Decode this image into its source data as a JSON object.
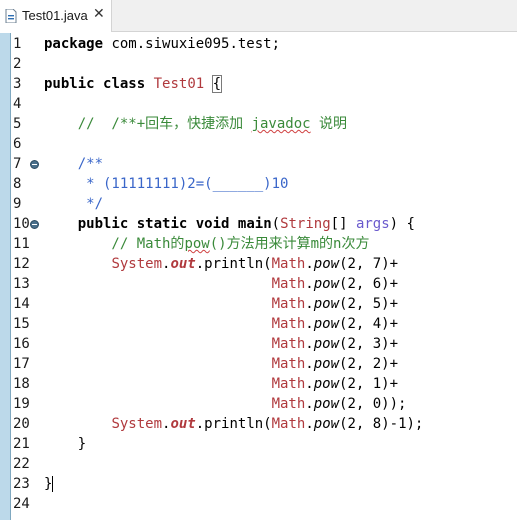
{
  "tab": {
    "icon": "java-file-icon",
    "title": "Test01.java",
    "close": "✕"
  },
  "code_lines": [
    {
      "n": "1",
      "tokens": [
        {
          "t": "package",
          "c": "kw"
        },
        {
          "t": " com.siwuxie095.test;",
          "c": ""
        }
      ]
    },
    {
      "n": "2",
      "tokens": []
    },
    {
      "n": "3",
      "tokens": [
        {
          "t": "public",
          "c": "kw"
        },
        {
          "t": " ",
          "c": ""
        },
        {
          "t": "class",
          "c": "kw"
        },
        {
          "t": " ",
          "c": ""
        },
        {
          "t": "Test01",
          "c": "cls"
        },
        {
          "t": " ",
          "c": ""
        },
        {
          "t": "{",
          "c": "brace-box"
        }
      ]
    },
    {
      "n": "4",
      "tokens": []
    },
    {
      "n": "5",
      "tokens": [
        {
          "t": "    //  /**+回车，快捷添加 ",
          "c": "cm"
        },
        {
          "t": "javadoc",
          "c": "cm squig"
        },
        {
          "t": " 说明",
          "c": "cm"
        }
      ]
    },
    {
      "n": "6",
      "tokens": []
    },
    {
      "n": "7",
      "fold": true,
      "tokens": [
        {
          "t": "    /**",
          "c": "jd"
        }
      ]
    },
    {
      "n": "8",
      "tokens": [
        {
          "t": "     * (11111111)2=(______)10",
          "c": "jd"
        }
      ]
    },
    {
      "n": "9",
      "tokens": [
        {
          "t": "     */",
          "c": "jd"
        }
      ]
    },
    {
      "n": "10",
      "fold": true,
      "tokens": [
        {
          "t": "    ",
          "c": ""
        },
        {
          "t": "public",
          "c": "kw"
        },
        {
          "t": " ",
          "c": ""
        },
        {
          "t": "static",
          "c": "kw"
        },
        {
          "t": " ",
          "c": ""
        },
        {
          "t": "void",
          "c": "kw"
        },
        {
          "t": " ",
          "c": ""
        },
        {
          "t": "main",
          "c": "kw"
        },
        {
          "t": "(",
          "c": ""
        },
        {
          "t": "String",
          "c": "cls"
        },
        {
          "t": "[] ",
          "c": ""
        },
        {
          "t": "args",
          "c": "param"
        },
        {
          "t": ") {",
          "c": ""
        }
      ]
    },
    {
      "n": "11",
      "tokens": [
        {
          "t": "        // Math的",
          "c": "cm"
        },
        {
          "t": "pow",
          "c": "cm squig"
        },
        {
          "t": "()方法用来计算m的n次方",
          "c": "cm"
        }
      ]
    },
    {
      "n": "12",
      "tokens": [
        {
          "t": "        ",
          "c": ""
        },
        {
          "t": "System",
          "c": "cls"
        },
        {
          "t": ".",
          "c": ""
        },
        {
          "t": "out",
          "c": "fld"
        },
        {
          "t": ".println(",
          "c": ""
        },
        {
          "t": "Math",
          "c": "cls"
        },
        {
          "t": ".",
          "c": ""
        },
        {
          "t": "pow",
          "c": "sm"
        },
        {
          "t": "(2, 7)+",
          "c": ""
        }
      ]
    },
    {
      "n": "13",
      "tokens": [
        {
          "t": "                           ",
          "c": ""
        },
        {
          "t": "Math",
          "c": "cls"
        },
        {
          "t": ".",
          "c": ""
        },
        {
          "t": "pow",
          "c": "sm"
        },
        {
          "t": "(2, 6)+",
          "c": ""
        }
      ]
    },
    {
      "n": "14",
      "tokens": [
        {
          "t": "                           ",
          "c": ""
        },
        {
          "t": "Math",
          "c": "cls"
        },
        {
          "t": ".",
          "c": ""
        },
        {
          "t": "pow",
          "c": "sm"
        },
        {
          "t": "(2, 5)+",
          "c": ""
        }
      ]
    },
    {
      "n": "15",
      "tokens": [
        {
          "t": "                           ",
          "c": ""
        },
        {
          "t": "Math",
          "c": "cls"
        },
        {
          "t": ".",
          "c": ""
        },
        {
          "t": "pow",
          "c": "sm"
        },
        {
          "t": "(2, 4)+",
          "c": ""
        }
      ]
    },
    {
      "n": "16",
      "tokens": [
        {
          "t": "                           ",
          "c": ""
        },
        {
          "t": "Math",
          "c": "cls"
        },
        {
          "t": ".",
          "c": ""
        },
        {
          "t": "pow",
          "c": "sm"
        },
        {
          "t": "(2, 3)+",
          "c": ""
        }
      ]
    },
    {
      "n": "17",
      "tokens": [
        {
          "t": "                           ",
          "c": ""
        },
        {
          "t": "Math",
          "c": "cls"
        },
        {
          "t": ".",
          "c": ""
        },
        {
          "t": "pow",
          "c": "sm"
        },
        {
          "t": "(2, 2)+",
          "c": ""
        }
      ]
    },
    {
      "n": "18",
      "tokens": [
        {
          "t": "                           ",
          "c": ""
        },
        {
          "t": "Math",
          "c": "cls"
        },
        {
          "t": ".",
          "c": ""
        },
        {
          "t": "pow",
          "c": "sm"
        },
        {
          "t": "(2, 1)+",
          "c": ""
        }
      ]
    },
    {
      "n": "19",
      "tokens": [
        {
          "t": "                           ",
          "c": ""
        },
        {
          "t": "Math",
          "c": "cls"
        },
        {
          "t": ".",
          "c": ""
        },
        {
          "t": "pow",
          "c": "sm"
        },
        {
          "t": "(2, 0));",
          "c": ""
        }
      ]
    },
    {
      "n": "20",
      "tokens": [
        {
          "t": "        ",
          "c": ""
        },
        {
          "t": "System",
          "c": "cls"
        },
        {
          "t": ".",
          "c": ""
        },
        {
          "t": "out",
          "c": "fld"
        },
        {
          "t": ".println(",
          "c": ""
        },
        {
          "t": "Math",
          "c": "cls"
        },
        {
          "t": ".",
          "c": ""
        },
        {
          "t": "pow",
          "c": "sm"
        },
        {
          "t": "(2, 8)-1);",
          "c": ""
        }
      ]
    },
    {
      "n": "21",
      "tokens": [
        {
          "t": "    }",
          "c": ""
        }
      ]
    },
    {
      "n": "22",
      "tokens": []
    },
    {
      "n": "23",
      "caret": true,
      "tokens": [
        {
          "t": "}",
          "c": ""
        }
      ]
    },
    {
      "n": "24",
      "tokens": []
    }
  ],
  "colors": {
    "keyword": "#000000",
    "class_name": "#b0393d",
    "comment": "#3a8a3a",
    "javadoc": "#3a66c9",
    "ruler": "#bcd9ea"
  }
}
